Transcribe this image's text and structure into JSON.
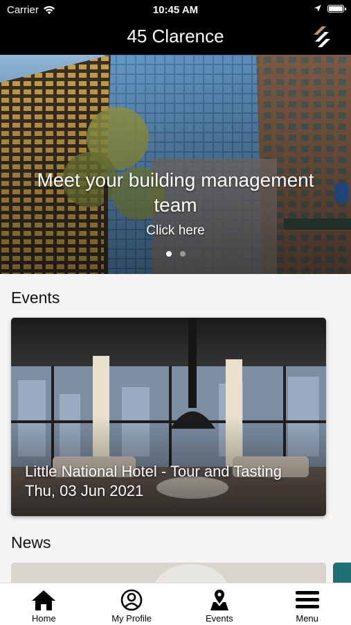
{
  "status": {
    "carrier": "Carrier",
    "time": "10:45 AM"
  },
  "header": {
    "title": "45 Clarence"
  },
  "hero": {
    "headline": "Meet your building management team",
    "cta": "Click here",
    "slide_count": 2,
    "active_slide": 1
  },
  "events": {
    "section_title": "Events",
    "items": [
      {
        "title": "Little National Hotel - Tour and Tasting",
        "date": "Thu, 03 Jun 2021"
      }
    ]
  },
  "news": {
    "section_title": "News"
  },
  "tabs": [
    {
      "label": "Home",
      "icon": "home-icon"
    },
    {
      "label": "My Profile",
      "icon": "profile-icon"
    },
    {
      "label": "Events",
      "icon": "events-icon"
    },
    {
      "label": "Menu",
      "icon": "menu-icon"
    }
  ]
}
